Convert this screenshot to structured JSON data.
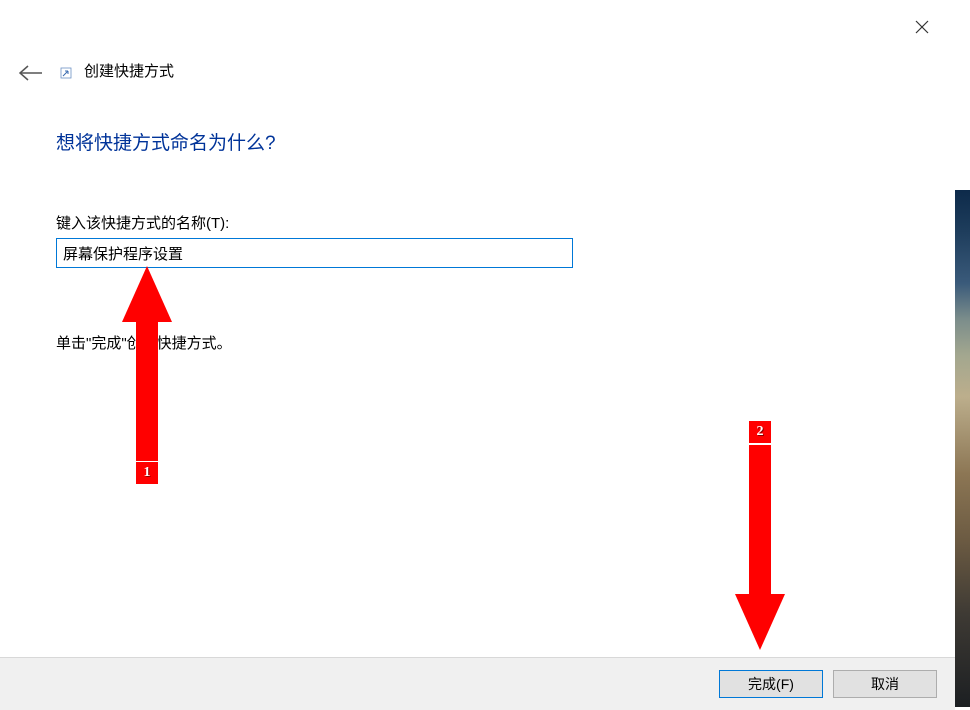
{
  "titlebar": {
    "close_aria": "关闭"
  },
  "header": {
    "back_aria": "返回",
    "title": "创建快捷方式"
  },
  "main": {
    "heading": "想将快捷方式命名为什么?",
    "name_label": "键入该快捷方式的名称(T):",
    "name_value": "屏幕保护程序设置",
    "instruction": "单击\"完成\"创建快捷方式。"
  },
  "buttons": {
    "finish": "完成(F)",
    "cancel": "取消"
  },
  "annotations": {
    "a1": "1",
    "a2": "2"
  }
}
